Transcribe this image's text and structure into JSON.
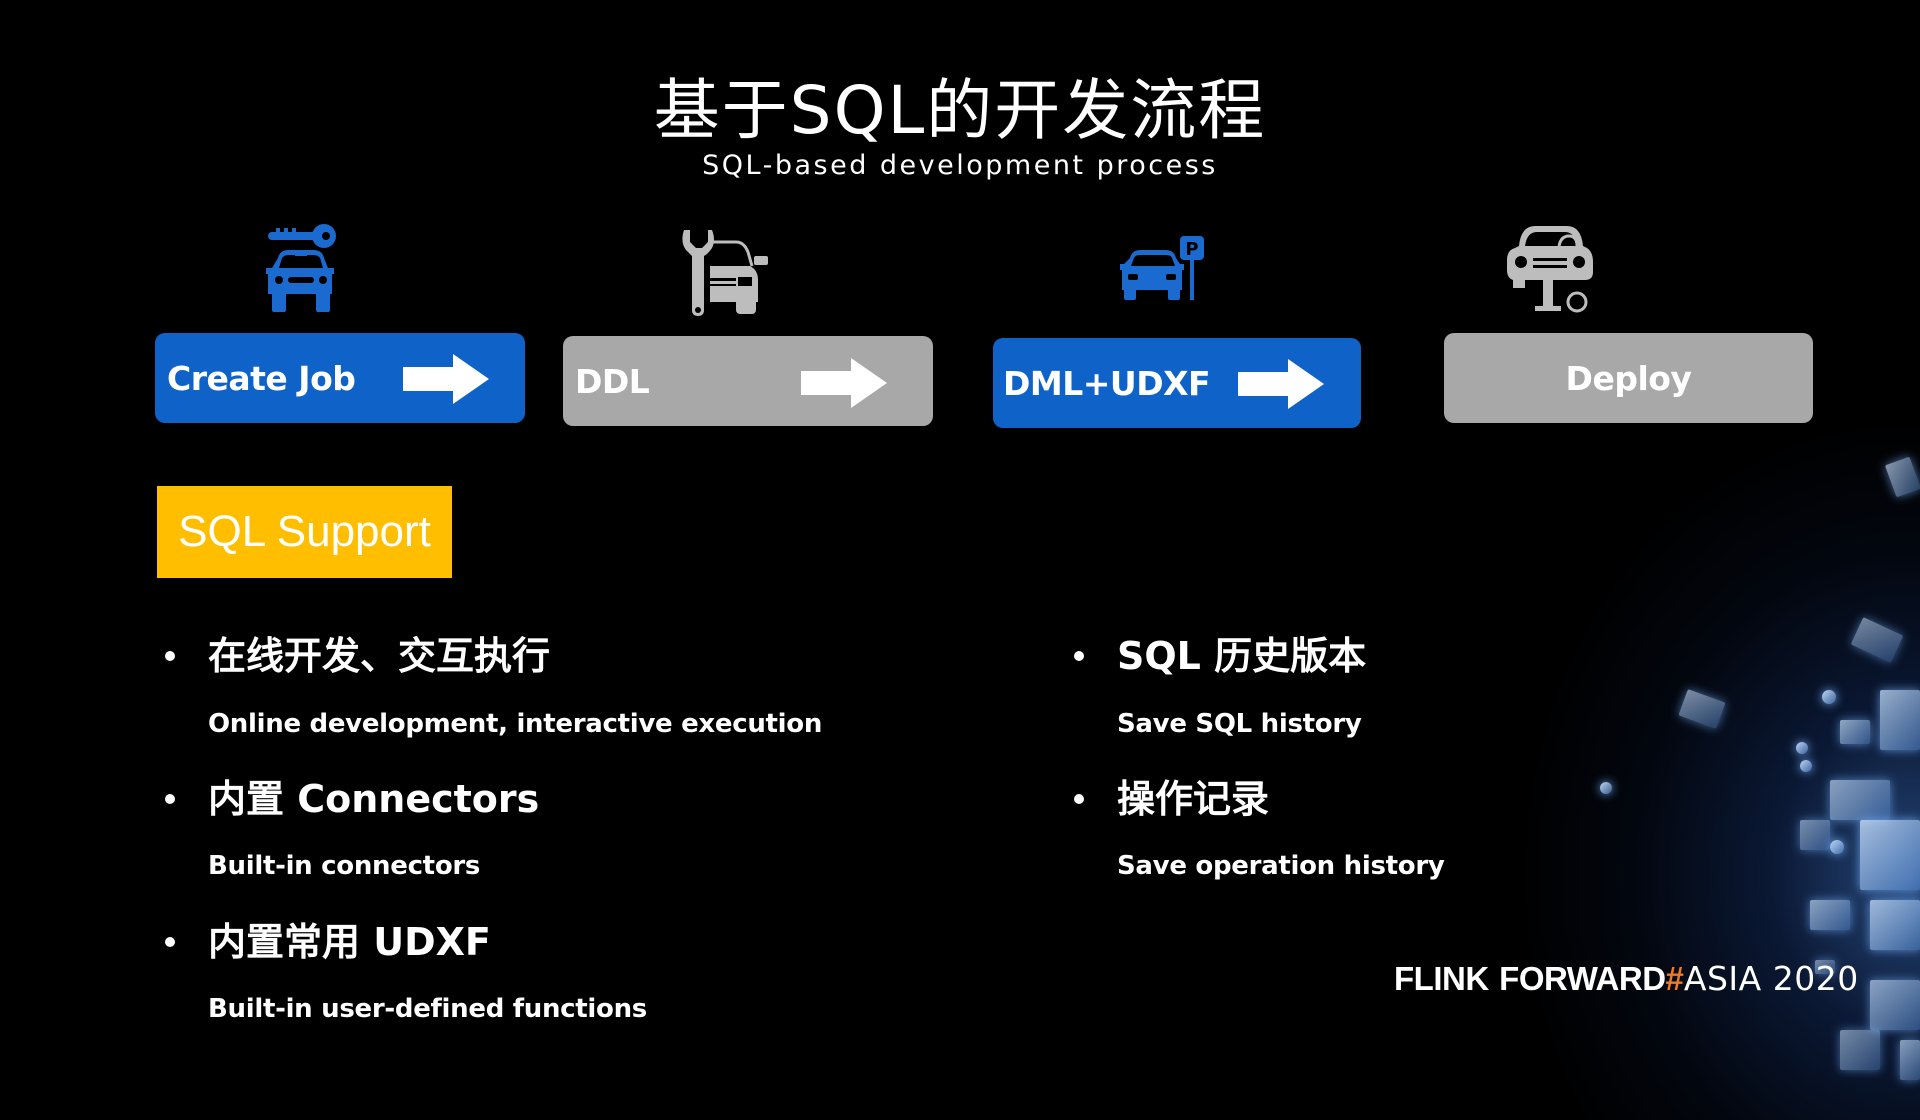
{
  "header": {
    "title": "基于SQL的开发流程",
    "subtitle": "SQL-based development process"
  },
  "steps": [
    {
      "label": "Create Job",
      "icon": "car-key-icon",
      "style": "blue",
      "has_arrow": true
    },
    {
      "label": "DDL",
      "icon": "car-repair-wrench-icon",
      "style": "gray",
      "has_arrow": true
    },
    {
      "label": "DML+UDXF",
      "icon": "car-parking-icon",
      "style": "blue",
      "has_arrow": true
    },
    {
      "label": "Deploy",
      "icon": "car-lift-icon",
      "style": "gray",
      "has_arrow": false
    }
  ],
  "badge": {
    "label": "SQL Support"
  },
  "features_left": [
    {
      "heading": "在线开发、交互执行",
      "sub": "Online development, interactive execution"
    },
    {
      "heading": "内置 Connectors",
      "sub": "Built-in connectors"
    },
    {
      "heading": "内置常用 UDXF",
      "sub": "Built-in user-defined functions"
    }
  ],
  "features_right": [
    {
      "heading": "SQL 历史版本",
      "sub": "Save SQL history"
    },
    {
      "heading": "操作记录",
      "sub": "Save operation history"
    }
  ],
  "logo": {
    "part1": "FLINK",
    "part2": "FORWARD",
    "hash": "#",
    "part3": "ASIA 2020"
  },
  "colors": {
    "background": "#000000",
    "step_blue": "#0f63c8",
    "step_gray": "#a8a8a8",
    "icon_blue": "#1a6ad0",
    "icon_gray": "#bdbdbd",
    "badge": "#ffbf00",
    "logo_hash": "#f07a1e"
  }
}
